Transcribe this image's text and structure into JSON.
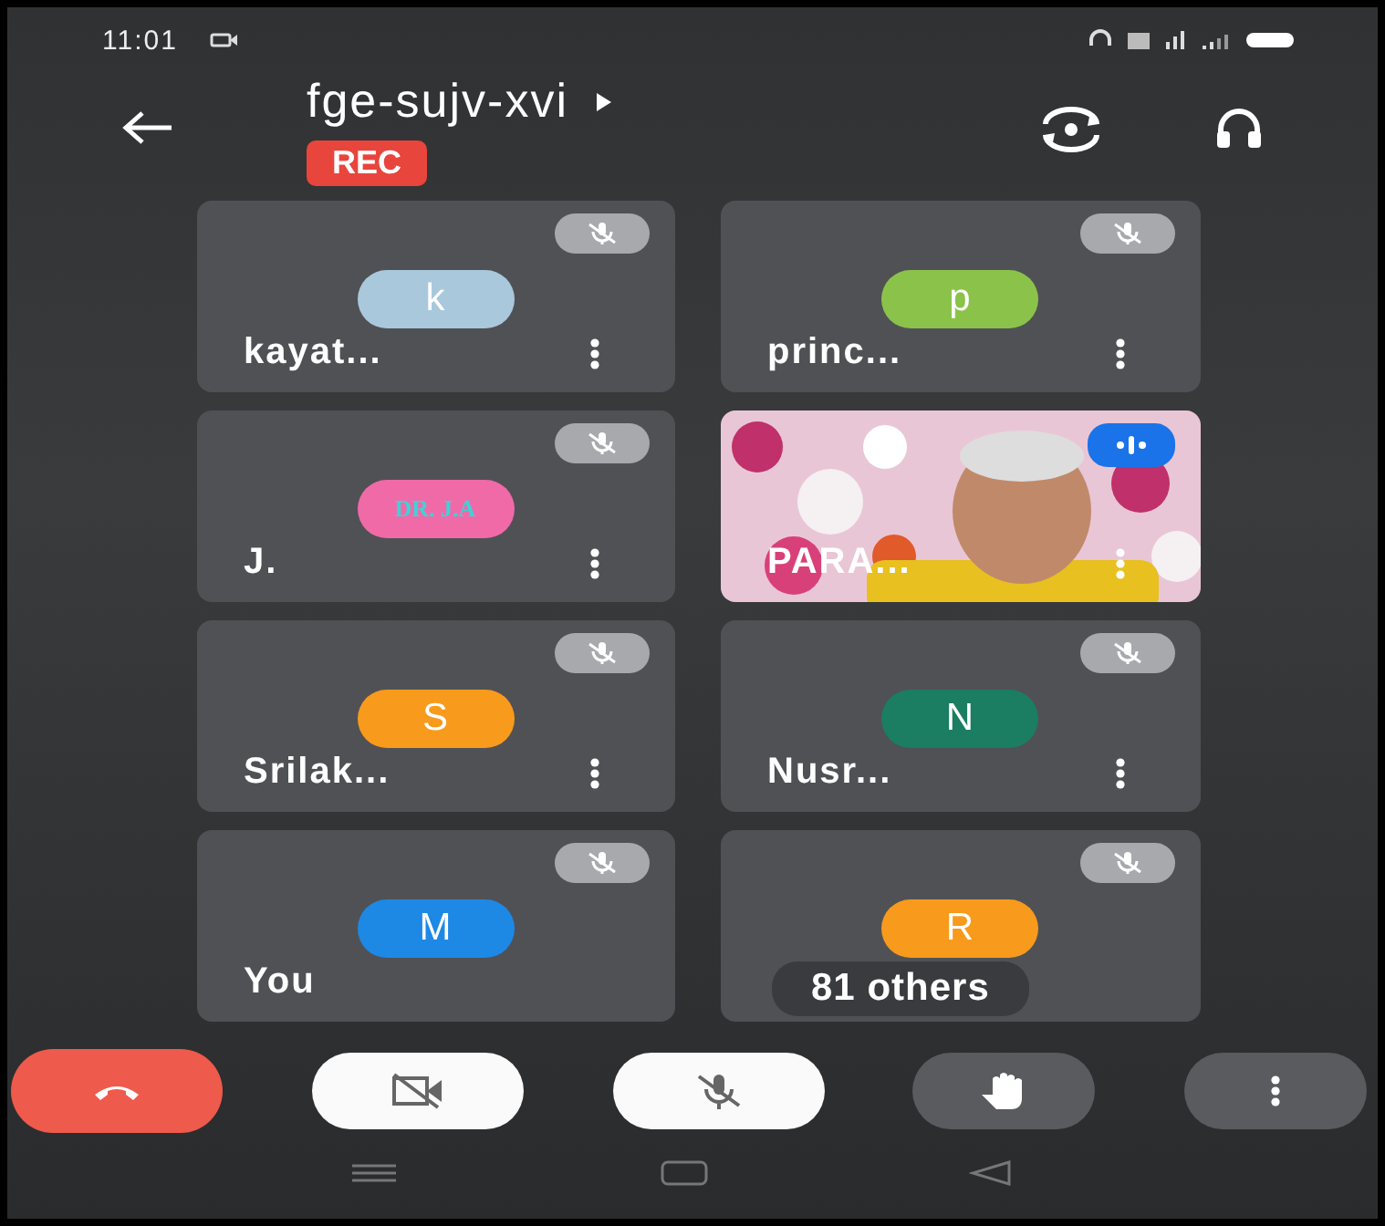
{
  "status_bar": {
    "time": "11:01"
  },
  "header": {
    "title": "fge-sujv-xvi",
    "recording": true,
    "rec_label": "REC"
  },
  "tiles": [
    {
      "kind": "avatar",
      "name": "kayat...",
      "initial": "k",
      "color": "#a9c8dc",
      "muted": true,
      "menu": true
    },
    {
      "kind": "avatar",
      "name": "princ...",
      "initial": "p",
      "color": "#8bc34a",
      "muted": true,
      "menu": true
    },
    {
      "kind": "avatar",
      "name": "J.",
      "initial": "DR. J.A",
      "color": "#f06aa8",
      "muted": true,
      "menu": true,
      "serif": true
    },
    {
      "kind": "video",
      "name": "PARA...",
      "muted": false,
      "speaking": true,
      "menu": true
    },
    {
      "kind": "avatar",
      "name": "Srilak...",
      "initial": "S",
      "color": "#f89a1c",
      "muted": true,
      "menu": true
    },
    {
      "kind": "avatar",
      "name": "Nusr...",
      "initial": "N",
      "color": "#1b7d62",
      "muted": true,
      "menu": true
    },
    {
      "kind": "avatar",
      "name": "You",
      "initial": "M",
      "color": "#1e88e5",
      "muted": true,
      "menu": false
    },
    {
      "kind": "others",
      "initial": "R",
      "color": "#f89a1c",
      "muted": true,
      "menu": false,
      "others_label": "81 others"
    }
  ],
  "controls": [
    {
      "kind": "end"
    },
    {
      "kind": "camera",
      "on": false
    },
    {
      "kind": "mic",
      "on": false
    },
    {
      "kind": "hand"
    },
    {
      "kind": "more"
    }
  ]
}
